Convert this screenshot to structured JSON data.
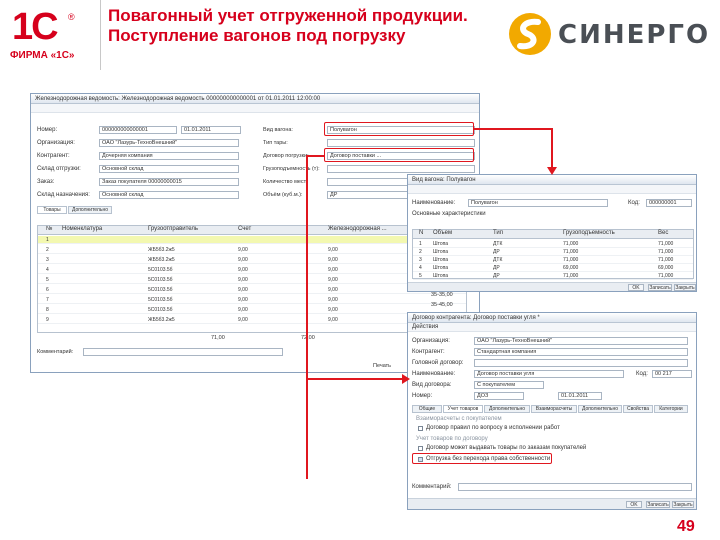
{
  "slide": {
    "title": "Повагонный учет отгруженной продукции. Поступление вагонов под погрузку",
    "page_number": "49",
    "logo_left": {
      "mark": "1С",
      "caption": "ФИРМА «1С»",
      "reg": "®"
    },
    "logo_right": {
      "text": "СИНЕРГО"
    },
    "accent_color": "#d6001c"
  },
  "main_window": {
    "title": "Железнодорожная ведомость: Железнодорожная ведомость 000000000000001 от 01.01.2011 12:00:00",
    "labels": [
      "Номер:",
      "Организация:",
      "Контрагент:",
      "Склад отгрузки:",
      "Заказ:",
      "Склад назначения:"
    ],
    "values": [
      "000000000000001",
      "ОАО \"Лазурь-ТехноВнешний\"",
      "Дочерняя компания",
      "Основной склад",
      "Заказ покупателя 00000000015",
      "Основной склад"
    ],
    "date_value": "01.01.2011",
    "right_labels": [
      "Вид вагона:",
      "Тип тары:",
      "Договор погрузки:",
      "Грузоподъемность (т):",
      "Количество мест:",
      "Объём (куб.м.):"
    ],
    "right_values": [
      "Полувагон",
      "",
      "Договор поставки ...",
      "",
      "",
      "ДР"
    ],
    "tabs": [
      "Товары",
      "Дополнительно"
    ],
    "grid_headers": [
      "№",
      "Номенклатура",
      "Грузоотправитель",
      "Счет",
      "Железнодорожная ..."
    ],
    "grid_rows": [
      {
        "n": "1",
        "name": "",
        "code": "",
        "qty": ""
      },
      {
        "n": "2",
        "name": "",
        "code": "ЖБ5б3.2ж5",
        "qty": "9,00"
      },
      {
        "n": "3",
        "name": "",
        "code": "ЖБ5б3.2ж5",
        "qty": "9,00"
      },
      {
        "n": "4",
        "name": "",
        "code": "5С0103.5б",
        "qty": "9,00"
      },
      {
        "n": "5",
        "name": "",
        "code": "5С0103.5б",
        "qty": "9,00"
      },
      {
        "n": "6",
        "name": "",
        "code": "5С0103.5б",
        "qty": "9,00"
      },
      {
        "n": "7",
        "name": "",
        "code": "5С0103.5б",
        "qty": "9,00"
      },
      {
        "n": "8",
        "name": "",
        "code": "5С0103.5б",
        "qty": "9,00"
      },
      {
        "n": "9",
        "name": "",
        "code": "ЖБ5б3.2ж5",
        "qty": "9,00"
      }
    ],
    "total": "71,00",
    "total2": "72,00",
    "side_values": [
      "35-35,00",
      "35-45,00"
    ],
    "comment_label": "Комментарий:",
    "print_label": "Печать",
    "ok_label": "OK"
  },
  "wagon_window": {
    "title": "Вид вагона: Полувагон",
    "name_label": "Наименование:",
    "name_value": "Полувагон",
    "code_label": "Код:",
    "code_value": "000000001",
    "group_label": "Основные характеристики",
    "headers": [
      "N",
      "Объем",
      "Тип",
      "Грузоподъемность",
      "Вес"
    ],
    "rows": [
      {
        "n": "1",
        "a": "Штопа",
        "b": "ДТК",
        "c": "71,000",
        "d": "71,000"
      },
      {
        "n": "2",
        "a": "Штопа",
        "b": "ДР",
        "c": "71,000",
        "d": "71,000"
      },
      {
        "n": "3",
        "a": "Штопа",
        "b": "ДТК",
        "c": "71,000",
        "d": "71,000"
      },
      {
        "n": "4",
        "a": "Штопа",
        "b": "ДР",
        "c": "69,000",
        "d": "69,000"
      },
      {
        "n": "5",
        "a": "Штопа",
        "b": "ДР",
        "c": "71,000",
        "d": "71,000"
      }
    ],
    "buttons": [
      "OK",
      "Записать",
      "Закрыть"
    ]
  },
  "contract_window": {
    "title": "Договор контрагента: Договор поставки угля *",
    "toolbar": "Действия",
    "labels": [
      "Организация:",
      "Контрагент:",
      "Головной договор:",
      "Наименование:",
      "Вид договора:",
      "Номер:"
    ],
    "values": [
      "ОАО \"Лазурь-ТехноВнешний\"",
      "Стандартная компания",
      "",
      "Договор поставки угля",
      "С покупателем",
      "ДОЗ"
    ],
    "code_label": "Код:",
    "code_value": "00 217",
    "date_value": "01.01.2011",
    "tabs": [
      "Общие",
      "Учет товаров",
      "Дополнительно",
      "Взаиморасчеты",
      "Дополнительно",
      "Свойства",
      "Категории"
    ],
    "section1": "Взаиморасчеты с покупателем",
    "check1": "Договор правил по вопросу в исполнении работ",
    "section2": "Учет товаров по договору",
    "check2": "Договор может выдавать товары по заказам покупателей",
    "check3": "Отгрузка без перехода права собственности",
    "comment_label": "Комментарий:",
    "buttons": [
      "OK",
      "Записать",
      "Закрыть"
    ]
  }
}
